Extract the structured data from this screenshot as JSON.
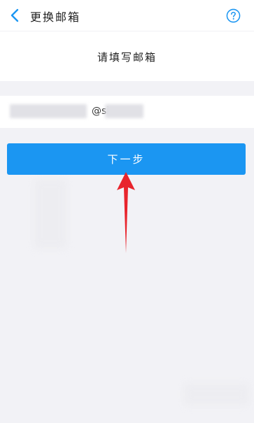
{
  "header": {
    "title": "更换邮箱",
    "back_icon": "chevron-left-icon",
    "help_icon": "question-circle-icon"
  },
  "hint": {
    "text": "请填写邮箱"
  },
  "email": {
    "visible_text": "@si"
  },
  "next_button": {
    "label": "下一步"
  },
  "colors": {
    "accent": "#1b96f2",
    "page_background": "#f2f2f6",
    "annotation_arrow": "#e8242c"
  }
}
